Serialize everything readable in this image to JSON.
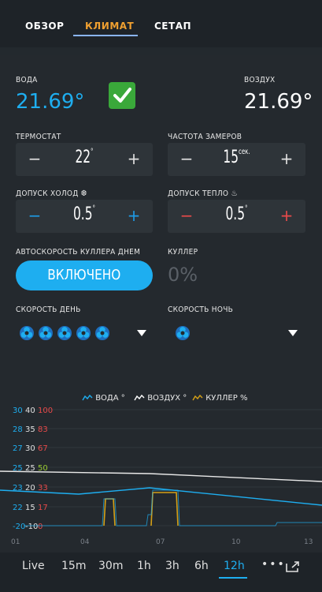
{
  "tabs": [
    {
      "label": "ОБЗОР"
    },
    {
      "label": "КЛИМАТ"
    },
    {
      "label": "СЕТАП"
    }
  ],
  "water": {
    "label": "ВОДА",
    "value": "21.69°"
  },
  "air": {
    "label": "ВОЗДУХ",
    "value": "21.69°"
  },
  "thermostat": {
    "label": "ТЕРМОСТАТ",
    "value": "22",
    "unit": "°"
  },
  "sample_rate": {
    "label": "ЧАСТОТА ЗАМЕРОВ",
    "value": "15",
    "unit": "сек."
  },
  "cold_tolerance": {
    "label": "ДОПУСК ХОЛОД ❆",
    "value": "0.5",
    "unit": "°"
  },
  "heat_tolerance": {
    "label": "ДОПУСК ТЕПЛО ♨",
    "value": "0.5",
    "unit": "°"
  },
  "auto_cooler": {
    "label": "АВТОСКОРОСТЬ КУЛЛЕРА ДНЕМ",
    "button": "ВКЛЮЧЕНО"
  },
  "cooler": {
    "label": "КУЛЛЕР",
    "value": "0%"
  },
  "speed_day": {
    "label": "СКОРОСТЬ ДЕНЬ",
    "fan_count": 5
  },
  "speed_night": {
    "label": "СКОРОСТЬ НОЧЬ",
    "fan_count": 1
  },
  "stepper_symbols": {
    "minus": "−",
    "plus": "+"
  },
  "chart_data": {
    "type": "line",
    "legend": [
      "ВОДА °",
      "ВОЗДУХ °",
      "КУЛЛЕР %"
    ],
    "legend_colors": [
      "#1eaef0",
      "#ffffff",
      "#d4a017"
    ],
    "y_labels_water": [
      "30",
      "28",
      "27",
      "25",
      "23",
      "22",
      "-20"
    ],
    "y_labels_air": [
      "40",
      "35",
      "30",
      "25",
      "20",
      "15",
      "-10"
    ],
    "y_labels_cooler": [
      "100",
      "83",
      "67",
      "50",
      "33",
      "17",
      "0"
    ],
    "x_labels": [
      "01",
      "04",
      "07",
      "10",
      "13"
    ],
    "series": [
      {
        "name": "ВОДА °",
        "color": "#1eaef0"
      },
      {
        "name": "ВОЗДУХ °",
        "color": "#ffffff"
      },
      {
        "name": "КУЛЛЕР %",
        "color": "#d4a017"
      }
    ]
  },
  "time_ranges": [
    "Live",
    "15m",
    "30m",
    "1h",
    "3h",
    "6h",
    "12h"
  ],
  "time_selected": "12h",
  "more": "•••"
}
